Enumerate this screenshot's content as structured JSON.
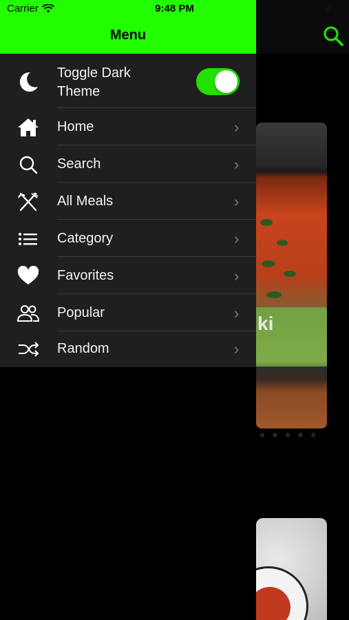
{
  "status_bar": {
    "carrier": "Carrier",
    "time": "9:48 PM"
  },
  "drawer": {
    "title": "Menu",
    "accent_color": "#22ff00",
    "dark_theme": {
      "label": "Toggle Dark Theme",
      "enabled": true,
      "icon": "moon-icon"
    },
    "items": [
      {
        "label": "Home",
        "icon": "home-icon"
      },
      {
        "label": "Search",
        "icon": "search-icon"
      },
      {
        "label": "All Meals",
        "icon": "fork-knife-icon"
      },
      {
        "label": "Category",
        "icon": "list-icon"
      },
      {
        "label": "Favorites",
        "icon": "heart-icon"
      },
      {
        "label": "Popular",
        "icon": "people-icon"
      },
      {
        "label": "Random",
        "icon": "shuffle-icon"
      }
    ]
  },
  "background": {
    "card_text_fragment": "ki",
    "search_icon": "search-icon"
  }
}
